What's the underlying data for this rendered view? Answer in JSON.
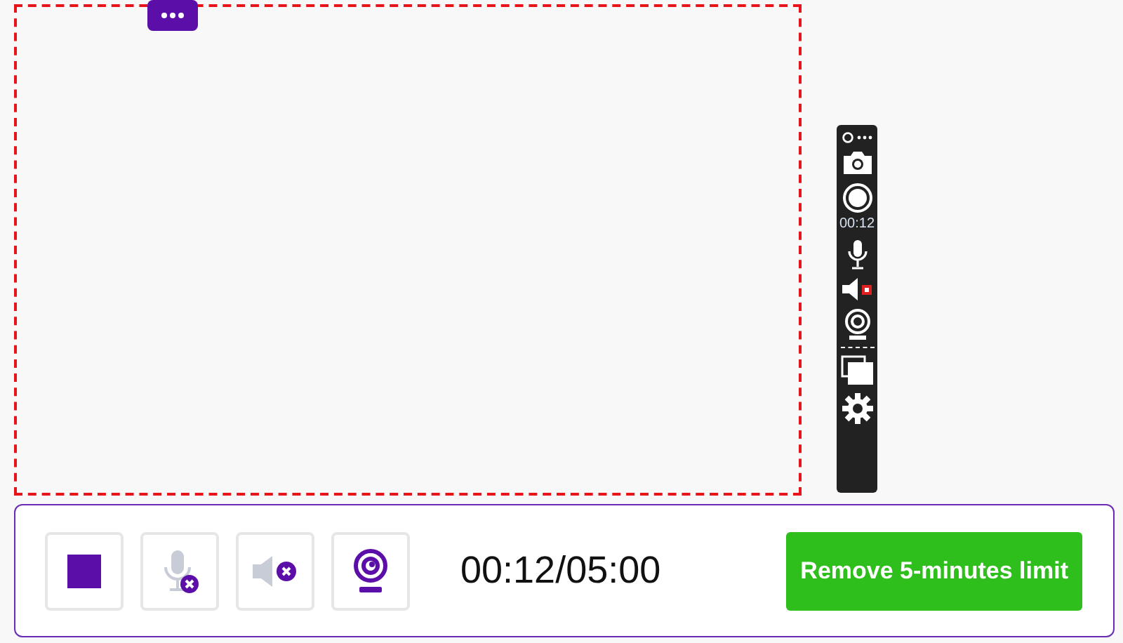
{
  "toolbar": {
    "timer": "00:12"
  },
  "controls": {
    "mic_muted": true,
    "speaker_muted": true,
    "webcam_on": true
  },
  "timer": "00:12/05:00",
  "upgrade_button": "Remove 5-minutes limit"
}
